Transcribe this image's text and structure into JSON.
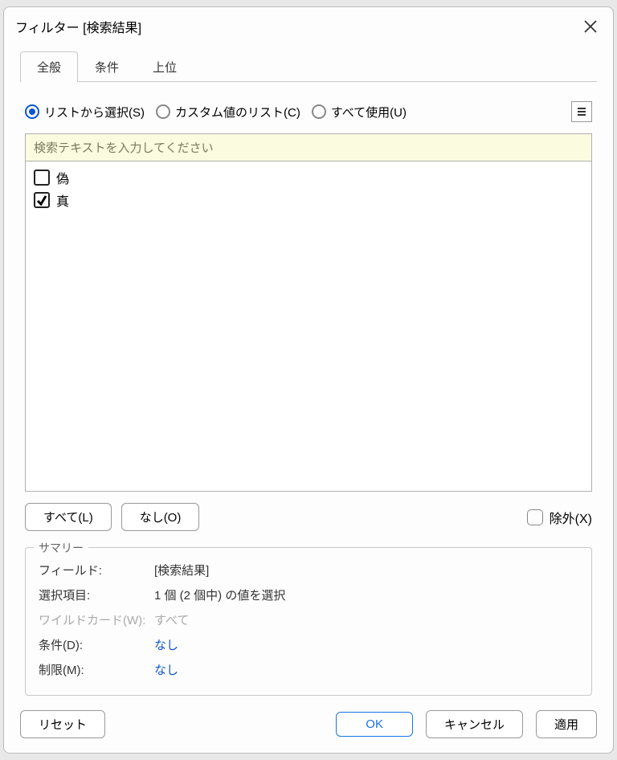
{
  "dialog": {
    "title": "フィルター [検索結果]"
  },
  "tabs": {
    "general": "全般",
    "condition": "条件",
    "top": "上位"
  },
  "mode": {
    "select_from_list": "リストから選択(S)",
    "custom_value_list": "カスタム値のリスト(C)",
    "use_all": "すべて使用(U)"
  },
  "search": {
    "placeholder": "検索テキストを入力してください"
  },
  "items": [
    {
      "label": "偽",
      "checked": false
    },
    {
      "label": "真",
      "checked": true
    }
  ],
  "buttons": {
    "all": "すべて(L)",
    "none": "なし(O)",
    "exclude": "除外(X)",
    "reset": "リセット",
    "ok": "OK",
    "cancel": "キャンセル",
    "apply": "適用"
  },
  "summary": {
    "title": "サマリー",
    "field_label": "フィールド:",
    "field_value": "[検索結果]",
    "selection_label": "選択項目:",
    "selection_value": "1 個 (2 個中) の値を選択",
    "wildcard_label": "ワイルドカード(W):",
    "wildcard_value": "すべて",
    "condition_label": "条件(D):",
    "condition_value": "なし",
    "limit_label": "制限(M):",
    "limit_value": "なし"
  }
}
